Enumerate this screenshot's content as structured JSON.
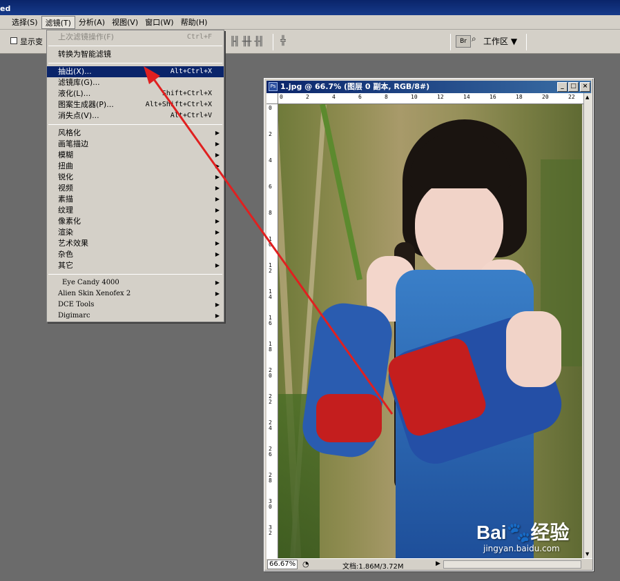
{
  "window": {
    "title_fragment": "ed"
  },
  "menubar": {
    "items": [
      {
        "label": "选择(S)"
      },
      {
        "label": "滤镜(T)",
        "active": true
      },
      {
        "label": "分析(A)"
      },
      {
        "label": "视图(V)"
      },
      {
        "label": "窗口(W)"
      },
      {
        "label": "帮助(H)"
      }
    ]
  },
  "options_bar": {
    "show_transform_label": "显示变",
    "workspace_label": "工作区 ▼",
    "bridge_label": "Br"
  },
  "filter_menu": {
    "last_filter": {
      "label": "上次滤镜操作(F)",
      "shortcut": "Ctrl+F"
    },
    "smart_filter": {
      "label": "转换为智能滤镜"
    },
    "extract": {
      "label": "抽出(X)...",
      "shortcut": "Alt+Ctrl+X"
    },
    "gallery": {
      "label": "滤镜库(G)..."
    },
    "liquify": {
      "label": "液化(L)...",
      "shortcut": "Shift+Ctrl+X"
    },
    "pattern_maker": {
      "label": "图案生成器(P)...",
      "shortcut": "Alt+Shift+Ctrl+X"
    },
    "vanishing_point": {
      "label": "消失点(V)...",
      "shortcut": "Alt+Ctrl+V"
    },
    "submenus": [
      {
        "label": "风格化"
      },
      {
        "label": "画笔描边"
      },
      {
        "label": "模糊"
      },
      {
        "label": "扭曲"
      },
      {
        "label": "锐化"
      },
      {
        "label": "视频"
      },
      {
        "label": "素描"
      },
      {
        "label": "纹理"
      },
      {
        "label": "像素化"
      },
      {
        "label": "渲染"
      },
      {
        "label": "艺术效果"
      },
      {
        "label": "杂色"
      },
      {
        "label": "其它"
      }
    ],
    "plugins": [
      {
        "label": "Eye Candy 4000"
      },
      {
        "label": "Alien Skin Xenofex 2"
      },
      {
        "label": "DCE Tools"
      },
      {
        "label": "Digimarc"
      }
    ]
  },
  "document": {
    "title": "1.jpg @ 66.7% (图层 0 副本, RGB/8#)",
    "ps_icon_label": "Ps",
    "zoom": "66.67%",
    "doc_size": "文档:1.86M/3.72M",
    "ruler_top": [
      "0",
      "2",
      "4",
      "6",
      "8",
      "10",
      "12",
      "14",
      "16",
      "18",
      "20",
      "22"
    ],
    "ruler_left": [
      "0",
      "2",
      "4",
      "6",
      "8",
      "10",
      "12",
      "14",
      "16",
      "18",
      "20",
      "22",
      "24",
      "26",
      "28",
      "30",
      "32"
    ]
  },
  "watermark": {
    "brand": "Bai",
    "brand2": "经验",
    "url": "jingyan.baidu.com"
  },
  "colors": {
    "menu_highlight": "#0a246a",
    "arrow": "#e02020",
    "chrome": "#d4d0c8"
  }
}
